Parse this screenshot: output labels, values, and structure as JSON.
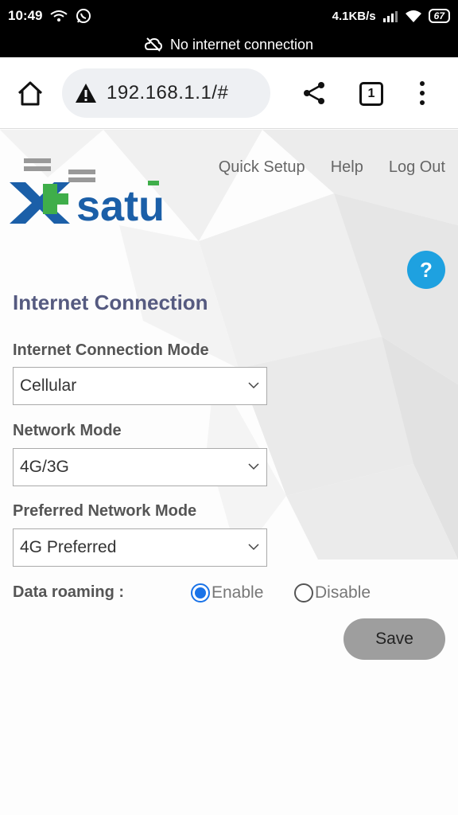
{
  "status_bar": {
    "time": "10:49",
    "net_speed": "4.1KB/s",
    "battery": "67"
  },
  "offline_banner": {
    "text": "No internet connection"
  },
  "browser": {
    "url": "192.168.1.1/#",
    "tab_count": "1"
  },
  "logo": {
    "text": "xsatu"
  },
  "topnav": {
    "quick_setup": "Quick Setup",
    "help": "Help",
    "logout": "Log Out"
  },
  "help_button": "?",
  "section": {
    "title": "Internet Connection"
  },
  "form": {
    "connection_mode": {
      "label": "Internet Connection Mode",
      "value": "Cellular"
    },
    "network_mode": {
      "label": "Network Mode",
      "value": "4G/3G"
    },
    "preferred_mode": {
      "label": "Preferred Network Mode",
      "value": "4G Preferred"
    },
    "roaming": {
      "label": "Data roaming :",
      "enable": "Enable",
      "disable": "Disable",
      "selected": "Enable"
    },
    "save_label": "Save"
  },
  "colors": {
    "accent": "#1a73e8",
    "help": "#1ea1e0",
    "title": "#555a80",
    "logo_blue": "#1b5fa8",
    "logo_green": "#3fae4a"
  }
}
